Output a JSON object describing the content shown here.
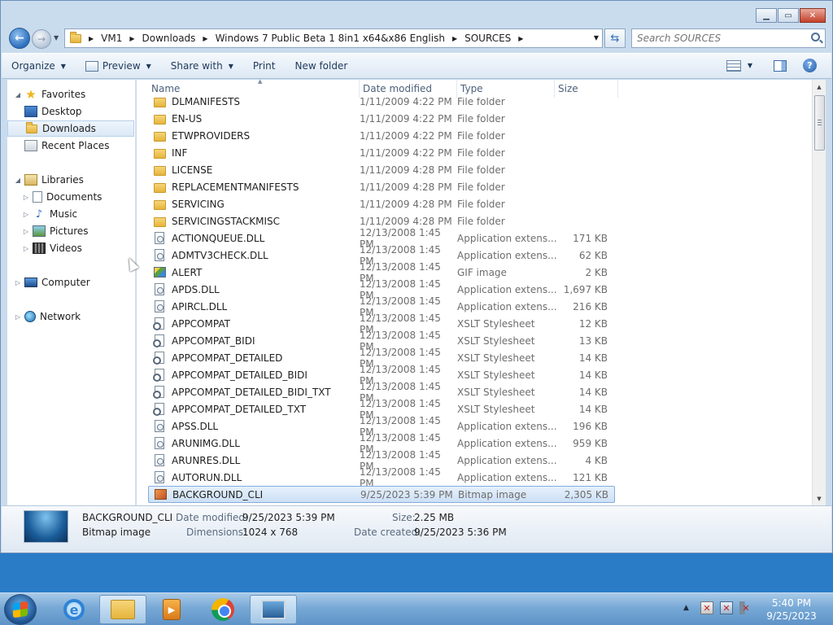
{
  "window": {
    "caption_min": "▁",
    "caption_max": "▭",
    "caption_close": "✕"
  },
  "address": {
    "crumbs": [
      "VM1",
      "Downloads",
      "Windows 7 Public Beta 1 8in1 x64&x86 English",
      "SOURCES"
    ],
    "search_placeholder": "Search SOURCES"
  },
  "commandbar": {
    "organize": "Organize",
    "preview": "Preview",
    "share_with": "Share with",
    "print": "Print",
    "new_folder": "New folder",
    "help": "?"
  },
  "nav": {
    "favorites": "Favorites",
    "desktop": "Desktop",
    "downloads": "Downloads",
    "recent_places": "Recent Places",
    "libraries": "Libraries",
    "documents": "Documents",
    "music": "Music",
    "pictures": "Pictures",
    "videos": "Videos",
    "computer": "Computer",
    "network": "Network"
  },
  "columns": {
    "name": "Name",
    "date_modified": "Date modified",
    "type": "Type",
    "size": "Size"
  },
  "files": [
    {
      "name": "DLMANIFESTS",
      "date": "1/11/2009 4:22 PM",
      "type": "File folder",
      "size": "",
      "icon": "folder"
    },
    {
      "name": "EN-US",
      "date": "1/11/2009 4:22 PM",
      "type": "File folder",
      "size": "",
      "icon": "folder"
    },
    {
      "name": "ETWPROVIDERS",
      "date": "1/11/2009 4:22 PM",
      "type": "File folder",
      "size": "",
      "icon": "folder"
    },
    {
      "name": "INF",
      "date": "1/11/2009 4:22 PM",
      "type": "File folder",
      "size": "",
      "icon": "folder"
    },
    {
      "name": "LICENSE",
      "date": "1/11/2009 4:28 PM",
      "type": "File folder",
      "size": "",
      "icon": "folder"
    },
    {
      "name": "REPLACEMENTMANIFESTS",
      "date": "1/11/2009 4:28 PM",
      "type": "File folder",
      "size": "",
      "icon": "folder"
    },
    {
      "name": "SERVICING",
      "date": "1/11/2009 4:28 PM",
      "type": "File folder",
      "size": "",
      "icon": "folder"
    },
    {
      "name": "SERVICINGSTACKMISC",
      "date": "1/11/2009 4:28 PM",
      "type": "File folder",
      "size": "",
      "icon": "folder"
    },
    {
      "name": "ACTIONQUEUE.DLL",
      "date": "12/13/2008 1:45 PM",
      "type": "Application extens...",
      "size": "171 KB",
      "icon": "dll"
    },
    {
      "name": "ADMTV3CHECK.DLL",
      "date": "12/13/2008 1:45 PM",
      "type": "Application extens...",
      "size": "62 KB",
      "icon": "dll"
    },
    {
      "name": "ALERT",
      "date": "12/13/2008 1:45 PM",
      "type": "GIF image",
      "size": "2 KB",
      "icon": "gif"
    },
    {
      "name": "APDS.DLL",
      "date": "12/13/2008 1:45 PM",
      "type": "Application extens...",
      "size": "1,697 KB",
      "icon": "dll"
    },
    {
      "name": "APIRCL.DLL",
      "date": "12/13/2008 1:45 PM",
      "type": "Application extens...",
      "size": "216 KB",
      "icon": "dll"
    },
    {
      "name": "APPCOMPAT",
      "date": "12/13/2008 1:45 PM",
      "type": "XSLT Stylesheet",
      "size": "12 KB",
      "icon": "xslt"
    },
    {
      "name": "APPCOMPAT_BIDI",
      "date": "12/13/2008 1:45 PM",
      "type": "XSLT Stylesheet",
      "size": "13 KB",
      "icon": "xslt"
    },
    {
      "name": "APPCOMPAT_DETAILED",
      "date": "12/13/2008 1:45 PM",
      "type": "XSLT Stylesheet",
      "size": "14 KB",
      "icon": "xslt"
    },
    {
      "name": "APPCOMPAT_DETAILED_BIDI",
      "date": "12/13/2008 1:45 PM",
      "type": "XSLT Stylesheet",
      "size": "14 KB",
      "icon": "xslt"
    },
    {
      "name": "APPCOMPAT_DETAILED_BIDI_TXT",
      "date": "12/13/2008 1:45 PM",
      "type": "XSLT Stylesheet",
      "size": "14 KB",
      "icon": "xslt"
    },
    {
      "name": "APPCOMPAT_DETAILED_TXT",
      "date": "12/13/2008 1:45 PM",
      "type": "XSLT Stylesheet",
      "size": "14 KB",
      "icon": "xslt"
    },
    {
      "name": "APSS.DLL",
      "date": "12/13/2008 1:45 PM",
      "type": "Application extens...",
      "size": "196 KB",
      "icon": "dll"
    },
    {
      "name": "ARUNIMG.DLL",
      "date": "12/13/2008 1:45 PM",
      "type": "Application extens...",
      "size": "959 KB",
      "icon": "dll"
    },
    {
      "name": "ARUNRES.DLL",
      "date": "12/13/2008 1:45 PM",
      "type": "Application extens...",
      "size": "4 KB",
      "icon": "dll"
    },
    {
      "name": "AUTORUN.DLL",
      "date": "12/13/2008 1:45 PM",
      "type": "Application extens...",
      "size": "121 KB",
      "icon": "dll"
    },
    {
      "name": "BACKGROUND_CLI",
      "date": "9/25/2023 5:39 PM",
      "type": "Bitmap image",
      "size": "2,305 KB",
      "icon": "bmp",
      "selected": true
    }
  ],
  "details": {
    "name": "BACKGROUND_CLI",
    "type": "Bitmap image",
    "date_modified_label": "Date modified:",
    "date_modified": "9/25/2023 5:39 PM",
    "dimensions_label": "Dimensions:",
    "dimensions": "1024 x 768",
    "size_label": "Size:",
    "size": "2.25 MB",
    "date_created_label": "Date created:",
    "date_created": "9/25/2023 5:36 PM"
  },
  "taskbar": {
    "time": "5:40 PM",
    "date": "9/25/2023",
    "ie_glyph": "e",
    "wmp_glyph": "▶",
    "tray_arrow": "▲",
    "tray_alert": "✕"
  }
}
